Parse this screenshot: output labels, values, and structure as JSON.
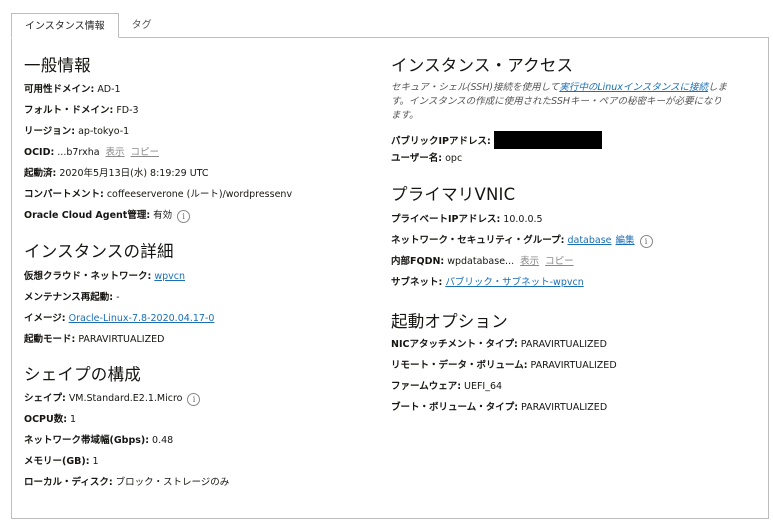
{
  "tabs": [
    {
      "label": "インスタンス情報"
    },
    {
      "label": "タグ"
    }
  ],
  "general": {
    "title": "一般情報",
    "ad_label": "可用性ドメイン:",
    "ad_value": "AD-1",
    "fd_label": "フォルト・ドメイン:",
    "fd_value": "FD-3",
    "region_label": "リージョン:",
    "region_value": "ap-tokyo-1",
    "ocid_label": "OCID:",
    "ocid_value": "...b7rxha",
    "ocid_show": "表示",
    "ocid_copy": "コピー",
    "launched_label": "起動済:",
    "launched_value": "2020年5月13日(水) 8:19:29 UTC",
    "compartment_label": "コンパートメント:",
    "compartment_value": "coffeeserverone (ルート)/wordpressenv",
    "agent_label": "Oracle Cloud Agent管理:",
    "agent_value": "有効"
  },
  "details": {
    "title": "インスタンスの詳細",
    "vcn_label": "仮想クラウド・ネットワーク:",
    "vcn_value": "wpvcn",
    "maint_label": "メンテナンス再起動:",
    "maint_value": "-",
    "image_label": "イメージ:",
    "image_value": "Oracle-Linux-7.8-2020.04.17-0",
    "launch_mode_label": "起動モード:",
    "launch_mode_value": "PARAVIRTUALIZED"
  },
  "shape": {
    "title": "シェイプの構成",
    "shape_label": "シェイプ:",
    "shape_value": "VM.Standard.E2.1.Micro",
    "ocpu_label": "OCPU数:",
    "ocpu_value": "1",
    "bw_label": "ネットワーク帯域幅(Gbps):",
    "bw_value": "0.48",
    "mem_label": "メモリー(GB):",
    "mem_value": "1",
    "disk_label": "ローカル・ディスク:",
    "disk_value": "ブロック・ストレージのみ"
  },
  "access": {
    "title": "インスタンス・アクセス",
    "desc_before": "セキュア・シェル(SSH)接続を使用して",
    "desc_link": "実行中のLinuxインスタンスに接続",
    "desc_after": "します。インスタンスの作成に使用されたSSHキー・ペアの秘密キーが必要になります。",
    "public_ip_label": "パブリックIPアドレス:",
    "user_label": "ユーザー名:",
    "user_value": "opc"
  },
  "vnic": {
    "title": "プライマリVNIC",
    "private_ip_label": "プライベートIPアドレス:",
    "private_ip_value": "10.0.0.5",
    "nsg_label": "ネットワーク・セキュリティ・グループ:",
    "nsg_value": "database",
    "nsg_edit": "編集",
    "fqdn_label": "内部FQDN:",
    "fqdn_value": "wpdatabase...",
    "fqdn_show": "表示",
    "fqdn_copy": "コピー",
    "subnet_label": "サブネット:",
    "subnet_value": "パブリック・サブネット-wpvcn"
  },
  "launch": {
    "title": "起動オプション",
    "nic_label": "NICアタッチメント・タイプ:",
    "nic_value": "PARAVIRTUALIZED",
    "remote_label": "リモート・データ・ボリューム:",
    "remote_value": "PARAVIRTUALIZED",
    "fw_label": "ファームウェア:",
    "fw_value": "UEFI_64",
    "boot_label": "ブート・ボリューム・タイプ:",
    "boot_value": "PARAVIRTUALIZED"
  }
}
